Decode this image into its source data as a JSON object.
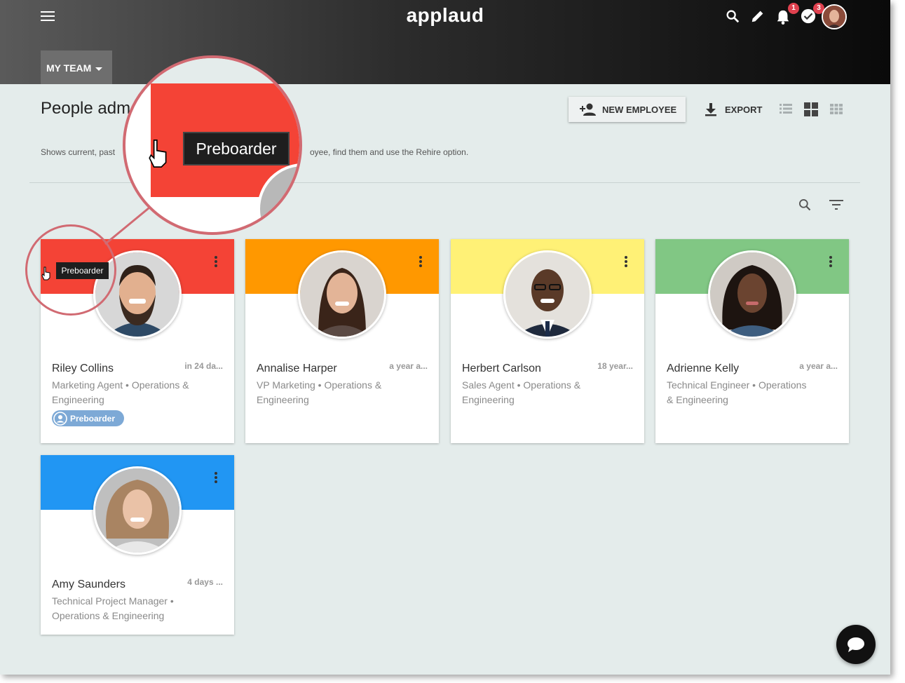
{
  "header": {
    "logo": "applaud",
    "notifications_count": "1",
    "tasks_count": "3",
    "team_tab": "MY TEAM"
  },
  "page": {
    "title": "People adm",
    "description_start": "Shows current, past",
    "description_end": "oyee, find them and use the Rehire option.",
    "new_employee_label": "NEW EMPLOYEE",
    "export_label": "EXPORT"
  },
  "tooltip": {
    "small": "Preboarder",
    "zoomed": "Preboarder"
  },
  "employees": [
    {
      "name": "Riley Collins",
      "date": "in 24 da...",
      "role": "Marketing Agent • Operations & Engineering",
      "color": "#f44336",
      "chip": "Preboarder"
    },
    {
      "name": "Annalise Harper",
      "date": "a year a...",
      "role": "VP Marketing • Operations & Engineering",
      "color": "#ff9800"
    },
    {
      "name": "Herbert Carlson",
      "date": "18 year...",
      "role": "Sales Agent • Operations & Engineering",
      "color": "#fff176"
    },
    {
      "name": "Adrienne Kelly",
      "date": "a year a...",
      "role": "Technical Engineer • Operations & Engineering",
      "color": "#81c784"
    },
    {
      "name": "Amy Saunders",
      "date": "4 days ...",
      "role": "Technical Project Manager • Operations & Engineering",
      "color": "#2196f3"
    }
  ]
}
